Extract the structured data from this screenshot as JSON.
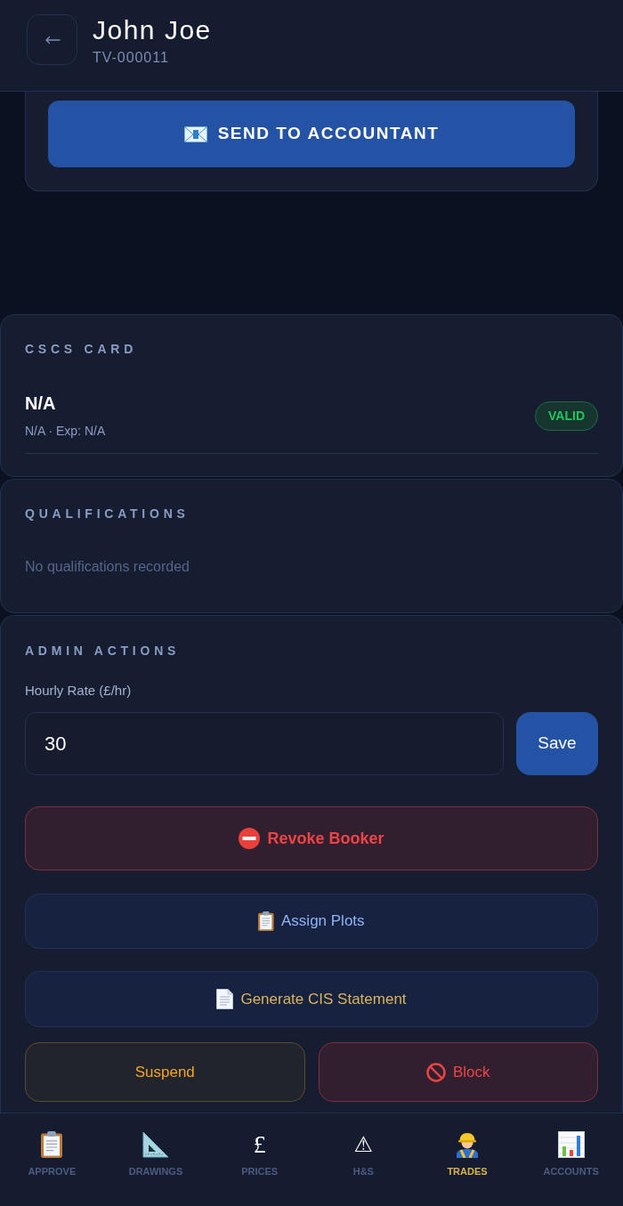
{
  "header": {
    "name": "John Joe",
    "id": "TV-000011"
  },
  "send_card": {
    "button": "SEND TO ACCOUNTANT"
  },
  "cscs_card": {
    "title": "CSCS CARD",
    "card_name": "N/A",
    "details": "N/A · Exp: N/A",
    "status": "VALID"
  },
  "qualifications": {
    "title": "QUALIFICATIONS",
    "empty_text": "No qualifications recorded"
  },
  "admin_actions": {
    "title": "ADMIN ACTIONS",
    "rate_field": {
      "label": "Hourly Rate (£/hr)",
      "value": "30"
    },
    "save_button": "Save",
    "actions": [
      {
        "label": "Revoke Booker",
        "kind": "danger"
      },
      {
        "label": "Assign Plots",
        "kind": "info"
      },
      {
        "label": "Generate CIS Statement",
        "kind": "gold"
      }
    ],
    "bottom_actions": [
      {
        "label": "Suspend",
        "kind": "warning"
      },
      {
        "label": "Block",
        "kind": "danger"
      }
    ]
  },
  "bottom_nav": [
    {
      "label": "APPROVE",
      "selected": false
    },
    {
      "label": "DRAWINGS",
      "selected": false
    },
    {
      "label": "PRICES",
      "glyph": "£",
      "selected": false
    },
    {
      "label": "H&S",
      "glyph": "⚠",
      "selected": false
    },
    {
      "label": "TRADES",
      "selected": true
    },
    {
      "label": "ACCOUNTS",
      "selected": false
    }
  ]
}
